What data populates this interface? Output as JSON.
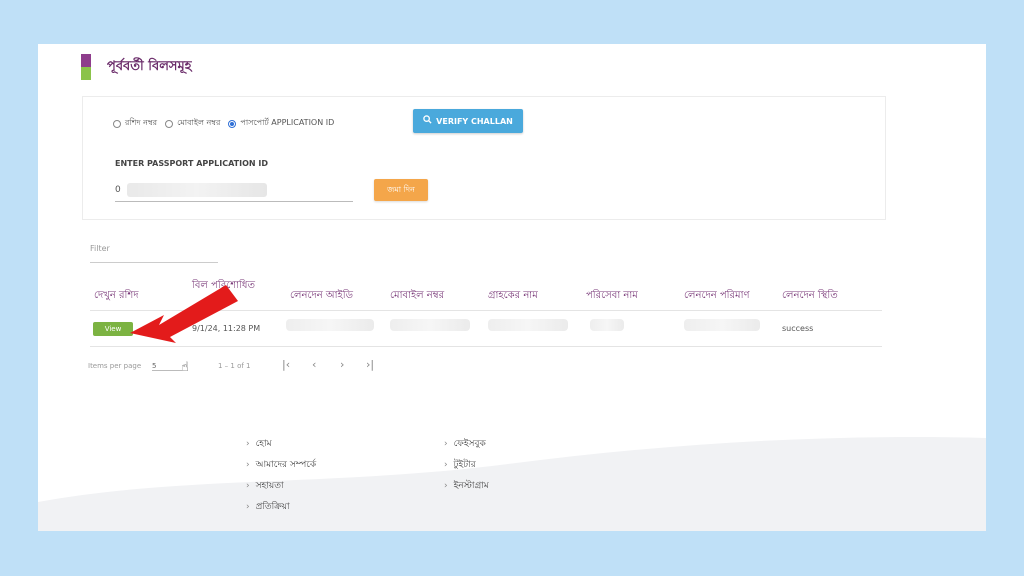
{
  "header": {
    "title": "পূর্ববর্তী বিলসমূহ"
  },
  "search": {
    "radios": [
      {
        "label": "রশিদ নম্বর",
        "selected": false
      },
      {
        "label": "মোবাইল নম্বর",
        "selected": false
      },
      {
        "label": "পাসপোর্ট APPLICATION ID",
        "selected": true
      }
    ],
    "verify_label": "VERIFY CHALLAN",
    "field_label": "ENTER PASSPORT APPLICATION ID",
    "field_value": "0",
    "submit_label": "জমা দিন"
  },
  "filter": {
    "placeholder": "Filter"
  },
  "table": {
    "headers": [
      "দেখুন রশিদ",
      "বিল পরিশোধিত",
      "লেনদেন আইডি",
      "মোবাইল নম্বর",
      "গ্রাহকের নাম",
      "পরিসেবা নাম",
      "লেনদেন পরিমাণ",
      "লেনদেন স্থিতি"
    ],
    "rows": [
      {
        "view_label": "View",
        "paid_date": "9/1/24, 11:28 PM",
        "status": "success"
      }
    ]
  },
  "paginator": {
    "items_per_page_label": "Items per page",
    "page_size": "5",
    "range": "1 – 1 of 1"
  },
  "footer": {
    "col1": [
      "হোম",
      "আমাদের সম্পর্কে",
      "সহায়তা",
      "প্রতিক্রিয়া"
    ],
    "col2": [
      "ফেইসবুক",
      "টুইটার",
      "ইনস্টাগ্রাম"
    ]
  },
  "colors": {
    "accent": "#8e3d8c",
    "verify_button": "#4aa9dc",
    "submit_button": "#f4a64a",
    "view_button": "#7cb342",
    "arrow": "#e31b1b"
  }
}
